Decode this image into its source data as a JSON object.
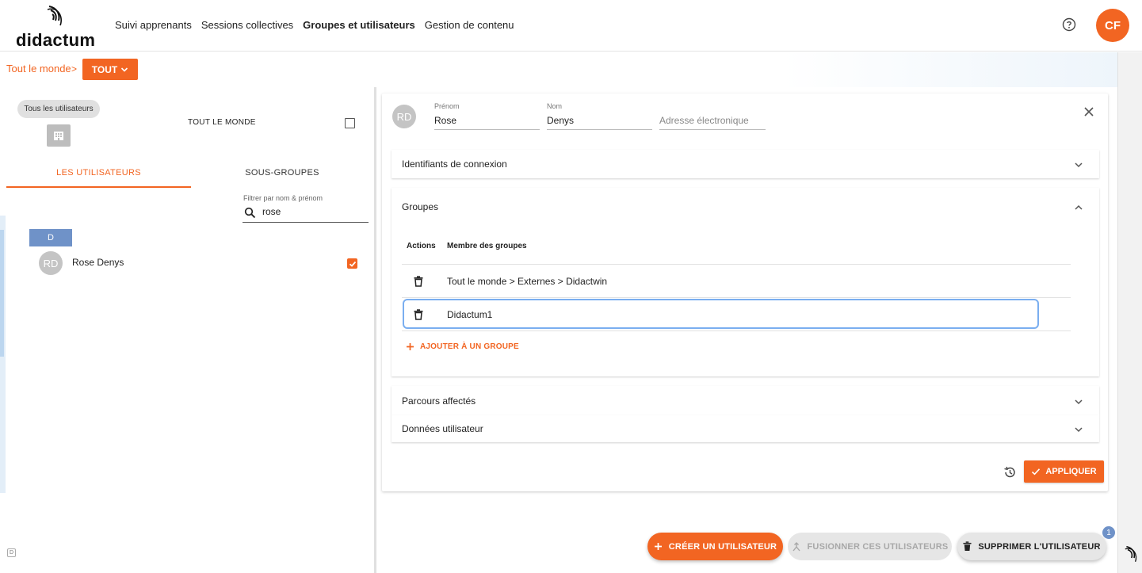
{
  "app": {
    "logo_text": "didactum",
    "nav": [
      "Suivi apprenants",
      "Sessions collectives",
      "Groupes et utilisateurs",
      "Gestion de contenu"
    ],
    "active_nav": "Groupes et utilisateurs",
    "user_initials": "CF",
    "accent": "#f26522"
  },
  "breadcrumb": {
    "root": "Tout le monde",
    "separator": ">",
    "current": "TOUT"
  },
  "left": {
    "chip_all": "Tous les utilisateurs",
    "group_label": "TOUT LE MONDE",
    "tabs": [
      "LES UTILISATEURS",
      "SOUS-GROUPES"
    ],
    "filter_label": "Filtrer par nom & prénom",
    "filter_value": "rose",
    "letter": "D",
    "users": [
      {
        "initials": "RD",
        "name": "Rose Denys",
        "checked": true
      }
    ],
    "corner_letter": "D"
  },
  "detail": {
    "initials": "RD",
    "first_name_label": "Prénom",
    "first_name": "Rose",
    "last_name_label": "Nom",
    "last_name": "Denys",
    "email_placeholder": "Adresse électronique",
    "sections": {
      "login": "Identifiants de connexion",
      "groups": "Groupes",
      "paths": "Parcours affectés",
      "data": "Données utilisateur"
    },
    "groups_table": {
      "headers": [
        "Actions",
        "Membre des groupes"
      ],
      "rows": [
        "Tout le monde > Externes > Didactwin",
        "Didactum1"
      ]
    },
    "add_group": "AJOUTER À UN GROUPE",
    "apply": "APPLIQUER"
  },
  "footer": {
    "create": "CRÉER UN UTILISATEUR",
    "merge": "FUSIONNER CES UTILISATEURS",
    "delete": "SUPPRIMER L'UTILISATEUR",
    "badge": "1"
  }
}
